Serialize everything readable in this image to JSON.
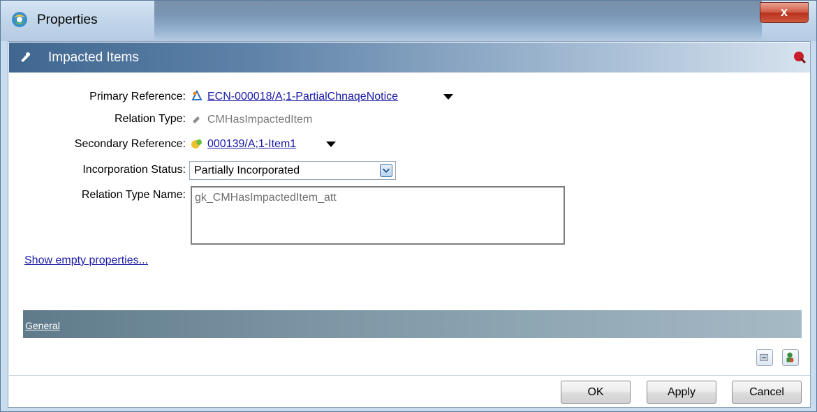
{
  "window": {
    "title": "Properties",
    "close_label": "x"
  },
  "section": {
    "title": "Impacted Items"
  },
  "fields": {
    "primary_reference": {
      "label": "Primary Reference:",
      "value": "ECN-000018/A;1-PartialChnaqeNotice"
    },
    "relation_type": {
      "label": "Relation Type:",
      "value": "CMHasImpactedItem"
    },
    "secondary_reference": {
      "label": "Secondary Reference:",
      "value": "000139/A;1-Item1"
    },
    "incorporation_status": {
      "label": "Incorporation Status:",
      "value": "Partially Incorporated"
    },
    "relation_type_name": {
      "label": "Relation Type Name:",
      "value": "gk_CMHasImpactedItem_att"
    }
  },
  "links": {
    "show_empty": "Show empty properties..."
  },
  "general_section": {
    "title": "General"
  },
  "buttons": {
    "ok": "OK",
    "apply": "Apply",
    "cancel": "Cancel"
  },
  "colors": {
    "link": "#1a1aa6",
    "header_start": "#3f6790",
    "close_red": "#b9321d"
  }
}
